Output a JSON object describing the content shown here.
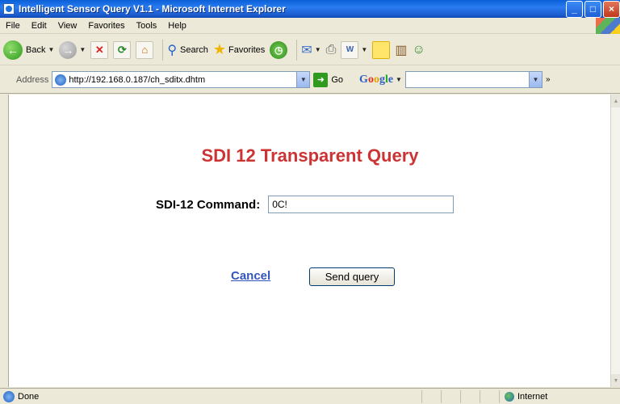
{
  "window": {
    "title": "Intelligent Sensor Query V1.1 - Microsoft Internet Explorer"
  },
  "menu": [
    "File",
    "Edit",
    "View",
    "Favorites",
    "Tools",
    "Help"
  ],
  "toolbar": {
    "back_label": "Back",
    "search_label": "Search",
    "favorites_label": "Favorites"
  },
  "address": {
    "label": "Address",
    "url": "http://192.168.0.187/ch_sditx.dhtm",
    "go_label": "Go"
  },
  "page": {
    "title": "SDI 12 Transparent Query",
    "command_label": "SDI-12 Command:",
    "command_value": "0C!",
    "cancel_label": "Cancel",
    "send_label": "Send query"
  },
  "status": {
    "text": "Done",
    "zone": "Internet"
  }
}
